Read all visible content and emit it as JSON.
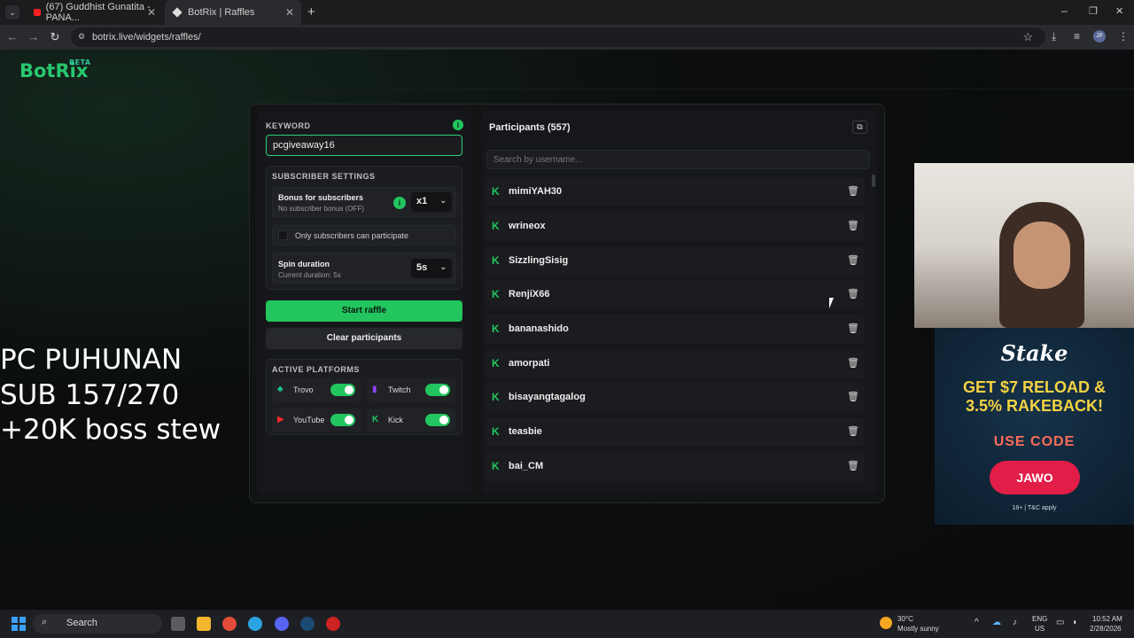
{
  "browser": {
    "tabs": [
      {
        "label": "(67) Guddhist Gunatita - PANA..."
      },
      {
        "label": "BotRix | Raffles"
      }
    ],
    "url": "botrix.live/widgets/raffles/"
  },
  "app": {
    "logo": "BotRix",
    "logo_badge": "BETA"
  },
  "keyword": {
    "label": "KEYWORD",
    "value": "pcgiveaway16"
  },
  "subscriber_settings": {
    "label": "SUBSCRIBER SETTINGS",
    "bonus_title": "Bonus for subscribers",
    "bonus_sub": "No subscriber bonus (OFF)",
    "bonus_value": "x1",
    "only_subs": "Only subscribers can participate",
    "spin_title": "Spin duration",
    "spin_sub": "Current duration: 5s",
    "spin_value": "5s"
  },
  "buttons": {
    "start": "Start raffle",
    "clear": "Clear participants"
  },
  "platforms": {
    "label": "ACTIVE PLATFORMS",
    "items": [
      {
        "name": "Trovo",
        "enabled": true
      },
      {
        "name": "Twitch",
        "enabled": true
      },
      {
        "name": "YouTube",
        "enabled": true
      },
      {
        "name": "Kick",
        "enabled": true
      }
    ]
  },
  "participants": {
    "title": "Participants (557)",
    "search_placeholder": "Search by username...",
    "list": [
      "mimiYAH30",
      "wrineox",
      "SizzlingSisig",
      "RenjiX66",
      "bananashido",
      "amorpati",
      "bisayangtagalog",
      "teasbie",
      "bai_CM"
    ]
  },
  "overlay": {
    "line1": "PC PUHUNAN",
    "line2": "SUB 157/270",
    "line3": "+20K boss stew"
  },
  "ad": {
    "brand": "Stake",
    "headline1": "GET $7 RELOAD &",
    "headline2": "3.5% RAKEBACK!",
    "use_code": "USE CODE",
    "code": "JAWO",
    "fine": "18+ | T&C apply"
  },
  "taskbar": {
    "search": "Search",
    "weather_temp": "30°C",
    "weather_desc": "Mostly sunny",
    "lang1": "ENG",
    "lang2": "US",
    "time": "10:52 AM",
    "date": "2/28/2026"
  },
  "colors": {
    "accent": "#22c55e",
    "background": "#0b0c0e"
  }
}
